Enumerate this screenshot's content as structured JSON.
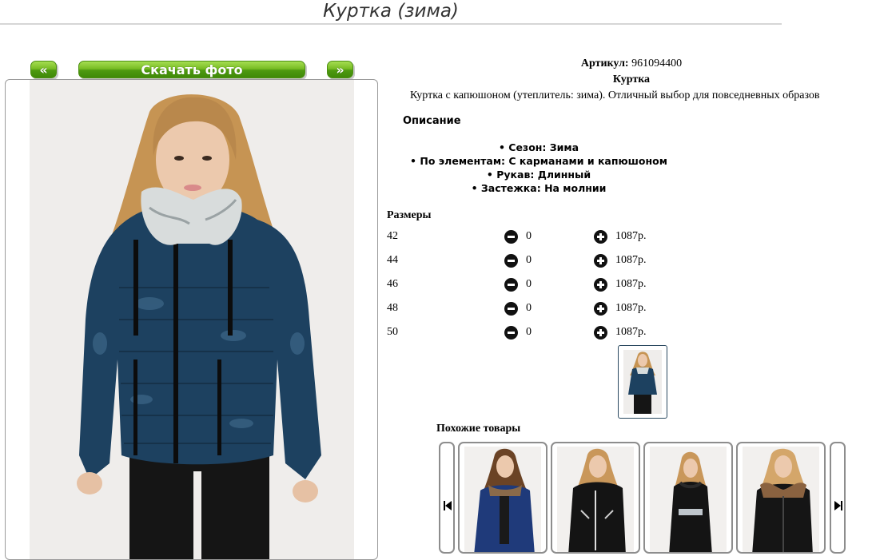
{
  "page": {
    "title": "Куртка (зима)"
  },
  "gallery": {
    "prev_label": "«",
    "next_label": "»",
    "download_label": "Скачать фото"
  },
  "product": {
    "article_label": "Артикул:",
    "article_value": "961094400",
    "name": "Куртка",
    "short_description": "Куртка с капюшоном (утеплитель: зима). Отличный выбор для повседневных образов",
    "description_heading": "Описание",
    "features": [
      "Сезон: Зима",
      "По элементам: С карманами и капюшоном",
      "Рукав: Длинный",
      "Застежка: На молнии"
    ]
  },
  "sizes": {
    "heading": "Размеры",
    "rows": [
      {
        "size": "42",
        "qty": "0",
        "price": "1087р."
      },
      {
        "size": "44",
        "qty": "0",
        "price": "1087р."
      },
      {
        "size": "46",
        "qty": "0",
        "price": "1087р."
      },
      {
        "size": "48",
        "qty": "0",
        "price": "1087р."
      },
      {
        "size": "50",
        "qty": "0",
        "price": "1087р."
      }
    ]
  },
  "similar": {
    "heading": "Похожие товары",
    "prev_icon": "skip-previous-icon",
    "next_icon": "skip-next-icon"
  },
  "colors": {
    "button_green": "#79bd25",
    "jacket_navy": "#1d4160",
    "hair_blonde": "#c9975a",
    "thumb_border": "#2a4960"
  }
}
